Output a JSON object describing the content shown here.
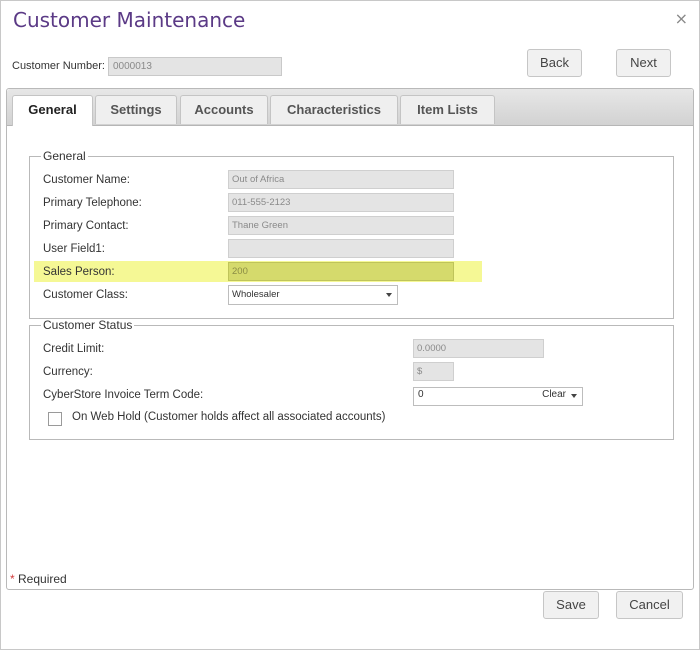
{
  "dialog": {
    "title": "Customer Maintenance",
    "close_glyph": "×"
  },
  "customer_number": {
    "label": "Customer Number:",
    "value": "0000013"
  },
  "nav": {
    "back_label": "Back",
    "next_label": "Next"
  },
  "tabs": [
    {
      "label": "General",
      "active": true
    },
    {
      "label": "Settings",
      "active": false
    },
    {
      "label": "Accounts",
      "active": false
    },
    {
      "label": "Characteristics",
      "active": false
    },
    {
      "label": "Item Lists",
      "active": false
    }
  ],
  "general": {
    "legend": "General",
    "fields": [
      {
        "label": "Customer Name:",
        "value": "Out of Africa"
      },
      {
        "label": "Primary Telephone:",
        "value": "011-555-2123"
      },
      {
        "label": "Primary Contact:",
        "value": "Thane Green"
      },
      {
        "label": "User Field1:",
        "value": ""
      },
      {
        "label": "Sales Person:",
        "value": "200"
      },
      {
        "label": "Customer Class:",
        "value": "Wholesaler"
      }
    ]
  },
  "status": {
    "legend": "Customer Status",
    "credit_limit": {
      "label": "Credit Limit:",
      "value": "0.0000"
    },
    "currency": {
      "label": "Currency:",
      "value": "$"
    },
    "term_code": {
      "label": "CyberStore Invoice Term Code:",
      "value": "0",
      "clear_label": "Clear"
    },
    "web_hold": {
      "label": "On Web Hold (Customer holds affect all associated accounts)",
      "checked": false
    }
  },
  "footer": {
    "required_star": "*",
    "required_label": " Required",
    "save_label": "Save",
    "cancel_label": "Cancel"
  },
  "colors": {
    "title": "#5b3a86",
    "highlight": "#f5f895",
    "required_star": "#d23b3b"
  }
}
